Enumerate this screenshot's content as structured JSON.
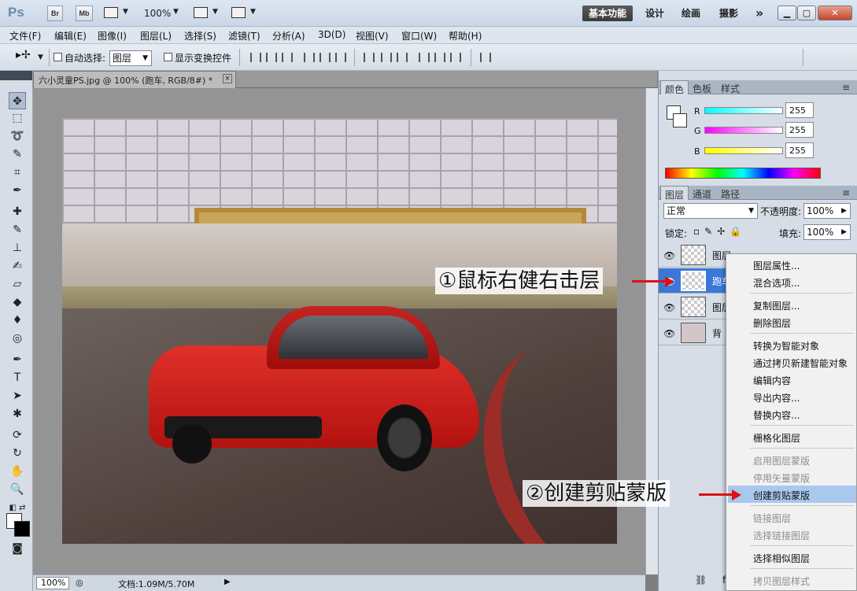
{
  "titlebar": {
    "logo": "Ps",
    "br_label": "Br",
    "mb_label": "Mb",
    "zoom": "100%",
    "workspaces": [
      "基本功能",
      "设计",
      "绘画",
      "摄影"
    ],
    "more": "»"
  },
  "menu": [
    "文件(F)",
    "编辑(E)",
    "图像(I)",
    "图层(L)",
    "选择(S)",
    "滤镜(T)",
    "分析(A)",
    "3D(D)",
    "视图(V)",
    "窗口(W)",
    "帮助(H)"
  ],
  "options": {
    "auto_select_label": "自动选择:",
    "auto_select_value": "图层",
    "show_transform_label": "显示变换控件"
  },
  "document": {
    "tab_title": "六小灵童PS.jpg @ 100% (跑车, RGB/8#) *",
    "close": "×"
  },
  "status": {
    "zoom": "100%",
    "doc_info": "文档:1.09M/5.70M"
  },
  "color_panel": {
    "tabs": [
      "颜色",
      "色板",
      "样式"
    ],
    "channels": [
      {
        "label": "R",
        "value": "255"
      },
      {
        "label": "G",
        "value": "255"
      },
      {
        "label": "B",
        "value": "255"
      }
    ]
  },
  "layers_panel": {
    "tabs": [
      "图层",
      "通道",
      "路径"
    ],
    "blend_mode": "正常",
    "opacity_label": "不透明度:",
    "opacity": "100%",
    "lock_label": "锁定:",
    "fill_label": "填充:",
    "fill": "100%",
    "layers": [
      {
        "name": "图层"
      },
      {
        "name": "跑车"
      },
      {
        "name": "图层"
      },
      {
        "name": "背"
      }
    ]
  },
  "context_menu": {
    "items": [
      {
        "label": "图层属性...",
        "enabled": true
      },
      {
        "label": "混合选项...",
        "enabled": true
      },
      {
        "label": "复制图层...",
        "enabled": true
      },
      {
        "label": "删除图层",
        "enabled": true
      },
      {
        "label": "转换为智能对象",
        "enabled": true
      },
      {
        "label": "通过拷贝新建智能对象",
        "enabled": true
      },
      {
        "label": "编辑内容",
        "enabled": true
      },
      {
        "label": "导出内容...",
        "enabled": true
      },
      {
        "label": "替换内容...",
        "enabled": true
      },
      {
        "label": "栅格化图层",
        "enabled": true
      },
      {
        "label": "启用图层蒙版",
        "enabled": false
      },
      {
        "label": "停用矢量蒙版",
        "enabled": false
      },
      {
        "label": "创建剪贴蒙版",
        "enabled": true,
        "highlighted": true
      },
      {
        "label": "链接图层",
        "enabled": false
      },
      {
        "label": "选择链接图层",
        "enabled": false
      },
      {
        "label": "选择相似图层",
        "enabled": true
      },
      {
        "label": "拷贝图层样式",
        "enabled": false
      }
    ]
  },
  "annotations": {
    "step1": "①鼠标右健右击层",
    "step2": "②创建剪贴蒙版"
  },
  "colors": {
    "accent_selection": "#3a78d8",
    "menu_highlight": "#a8c8ee",
    "arrow": "#dd1111"
  },
  "icons": [
    "move-tool-icon",
    "marquee-icon",
    "lasso-icon",
    "quick-select-icon",
    "crop-icon",
    "eyedropper-icon",
    "heal-icon",
    "brush-icon",
    "stamp-icon",
    "history-brush-icon",
    "eraser-icon",
    "bucket-icon",
    "blur-icon",
    "dodge-icon",
    "pen-icon",
    "type-icon",
    "path-select-icon",
    "shape-icon",
    "3d-rotate-icon",
    "3d-orbit-icon",
    "hand-icon",
    "zoom-icon",
    "eye-icon"
  ]
}
